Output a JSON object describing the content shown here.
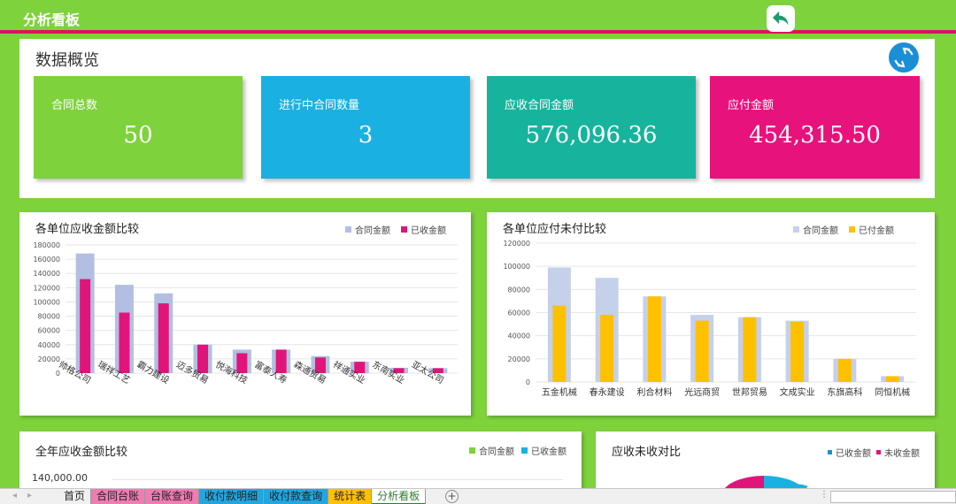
{
  "header": {
    "title": "分析看板"
  },
  "overview": {
    "heading": "数据概览",
    "cards": [
      {
        "label": "合同总数",
        "value": "50",
        "color": "#7ed23c"
      },
      {
        "label": "进行中合同数量",
        "value": "3",
        "color": "#1ab0e2"
      },
      {
        "label": "应收合同金额",
        "value": "576,096.36",
        "color": "#16b49c"
      },
      {
        "label": "应付金额",
        "value": "454,315.50",
        "color": "#e8127c"
      }
    ]
  },
  "chart_data": [
    {
      "type": "bar",
      "title": "各单位应收金额比较",
      "categories": [
        "帅格公司",
        "瑞祥工艺",
        "霸力建设",
        "迈多贸易",
        "悦海科技",
        "富泰人寿",
        "森通贸易",
        "祥通实业",
        "东南实业",
        "亚太公司"
      ],
      "series": [
        {
          "name": "合同金额",
          "color": "#b3bfe2",
          "values": [
            168000,
            124000,
            112000,
            40000,
            33000,
            33000,
            24000,
            16000,
            7500,
            7000
          ]
        },
        {
          "name": "已收金额",
          "color": "#e0157a",
          "values": [
            132000,
            85000,
            98000,
            40000,
            28000,
            33000,
            22000,
            16000,
            7000,
            7000
          ]
        }
      ],
      "yticks": [
        "0",
        "20000",
        "40000",
        "60000",
        "80000",
        "100000",
        "120000",
        "140000",
        "160000",
        "180000"
      ],
      "ylim": [
        0,
        180000
      ],
      "legend": "top-right"
    },
    {
      "type": "bar",
      "title": "各单位应付未付比较",
      "categories": [
        "五金机械",
        "春永建设",
        "利合材料",
        "光远商贸",
        "世邦贸易",
        "文成实业",
        "东旗高科",
        "同恒机械"
      ],
      "series": [
        {
          "name": "合同金额",
          "color": "#c5d0eb",
          "values": [
            99000,
            90000,
            74000,
            58000,
            56000,
            53000,
            20000,
            5000
          ]
        },
        {
          "name": "已付金额",
          "color": "#ffc000",
          "values": [
            66000,
            58000,
            74000,
            53000,
            56000,
            52000,
            20000,
            5000
          ]
        }
      ],
      "yticks": [
        "0",
        "20000",
        "40000",
        "60000",
        "80000",
        "100000",
        "120000"
      ],
      "ylim": [
        0,
        120000
      ],
      "legend": "top-right"
    }
  ],
  "bottom_left": {
    "title": "全年应收金额比较",
    "legend": [
      {
        "name": "合同金额",
        "color": "#7ed23c"
      },
      {
        "name": "已收金额",
        "color": "#1ab0e2"
      }
    ],
    "first_tick": "140,000.00"
  },
  "bottom_right": {
    "title": "应收未收对比",
    "legend": [
      {
        "name": "已收金额",
        "color": "#1a8fd6"
      },
      {
        "name": "未收金额",
        "color": "#e0157a"
      }
    ]
  },
  "sheet_tabs": [
    {
      "label": "首页",
      "color": "#f0f0f0"
    },
    {
      "label": "合同台账",
      "color": "#f07cb4"
    },
    {
      "label": "台账查询",
      "color": "#f07cb4"
    },
    {
      "label": "收付款明细",
      "color": "#22a6df"
    },
    {
      "label": "收付款查询",
      "color": "#22a6df"
    },
    {
      "label": "统计表",
      "color": "#ffc000"
    },
    {
      "label": "分析看板",
      "color": "#ffffff"
    }
  ],
  "icons": {
    "back": "reply-arrow-icon",
    "refresh": "refresh-icon",
    "add_sheet": "plus-circle-icon"
  }
}
